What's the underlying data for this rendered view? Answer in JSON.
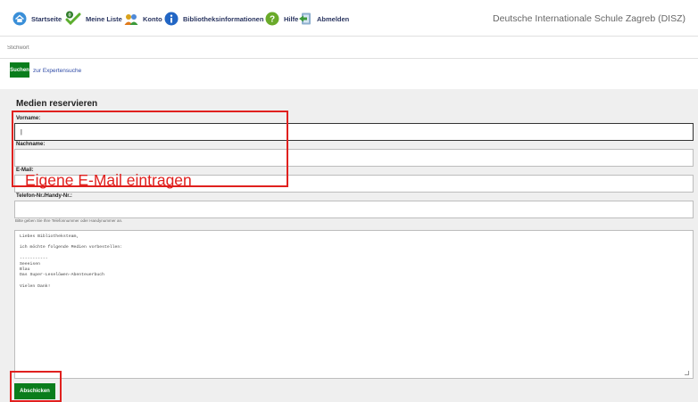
{
  "nav": {
    "items": [
      {
        "label": "Startseite",
        "icon": "home-icon"
      },
      {
        "label": "Meine Liste",
        "icon": "list-check-icon",
        "badge": "0"
      },
      {
        "label": "Konto",
        "icon": "account-users-icon"
      },
      {
        "label": "Bibliotheksinformationen",
        "icon": "info-icon"
      },
      {
        "label": "Hilfe",
        "icon": "help-icon"
      },
      {
        "label": "Abmelden",
        "icon": "logout-icon"
      }
    ],
    "school": "Deutsche Internationale Schule Zagreb (DISZ)"
  },
  "search": {
    "placeholder": "Stichwort",
    "button_label": "Suchen",
    "expert_link": "zur Expertensuche"
  },
  "form": {
    "title": "Medien reservieren",
    "fields": [
      {
        "label": "Vorname:",
        "value": "|"
      },
      {
        "label": "Nachname:",
        "value": ""
      },
      {
        "label": "E-Mail:",
        "value": ""
      },
      {
        "label": "Telefon-Nr./Handy-Nr.:",
        "value": ""
      }
    ],
    "hint": "Bitte geben Sie Ihre Telefonnummer oder Handynummer an.",
    "message": "Liebes Bibliotheksteam,\n\nich möchte folgende Medien vorbestellen:\n\n-----------\nSeeeisen\nBlau\nDas Super-Leselöwen-Abenteuerbuch\n\nVielen Dank!",
    "submit_label": "Abschicken"
  },
  "annotation": {
    "text": "Eigene E-Mail eintragen",
    "color": "#e0201e"
  },
  "colors": {
    "accent_green": "#0a7d1c",
    "nav_text": "#2a3560"
  }
}
